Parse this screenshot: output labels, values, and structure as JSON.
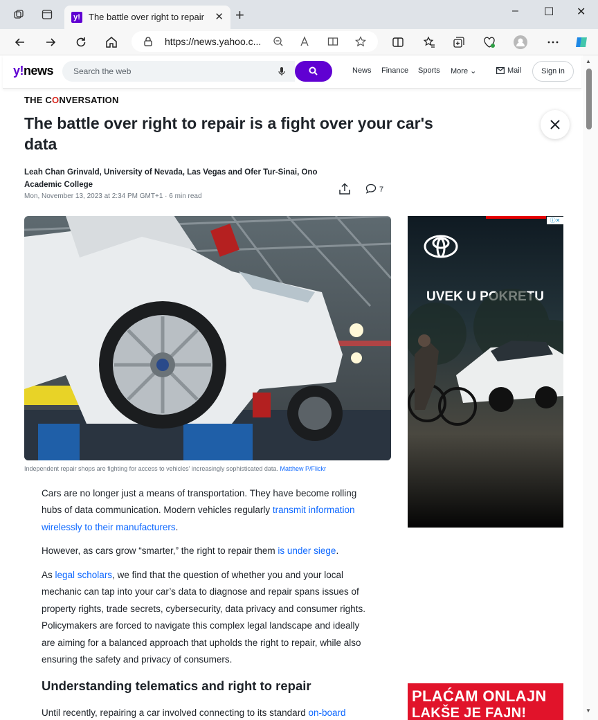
{
  "browser": {
    "tab_title": "The battle over right to repair is a fight over your car's data",
    "tab_favicon_letter": "y!",
    "url": "https://news.yahoo.c...",
    "window_minimize": "–",
    "window_maximize": "☐",
    "window_close": "✕"
  },
  "yahoo_header": {
    "logo_prefix": "y!",
    "logo_suffix": "news",
    "search_placeholder": "Search the web",
    "nav": [
      "News",
      "Finance",
      "Sports",
      "More"
    ],
    "more_chevron": "⌄",
    "mail_label": "Mail",
    "signin_label": "Sign in"
  },
  "article": {
    "source_pre": "THE C",
    "source_o": "O",
    "source_post": "NVERSATION",
    "headline": "The battle over right to repair is a fight over your car's data",
    "byline": "Leah Chan Grinvald, University of Nevada, Las Vegas and Ofer Tur-Sinai, Ono Academic College",
    "date": "Mon, November 13, 2023 at 2:34 PM GMT+1",
    "separator": "·",
    "read_time": "6 min read",
    "comment_count": "7",
    "caption_text": "Independent repair shops are fighting for access to vehicles' increasingly sophisticated data.",
    "caption_credit": "Matthew P/Flickr",
    "p1_a": "Cars are no longer just a means of transportation. They have become rolling hubs of data communication. Modern vehicles regularly ",
    "p1_link": "transmit information wirelessly to their manufacturers",
    "p1_b": ".",
    "p2_a": "However, as cars grow “smarter,” the right to repair them ",
    "p2_link": "is under siege",
    "p2_b": ".",
    "p3_a": "As ",
    "p3_link": "legal scholars",
    "p3_b": ", we find that the question of whether you and your local mechanic can tap into your car’s data to diagnose and repair spans issues of property rights, trade secrets, cybersecurity, data privacy and consumer rights. Policymakers are forced to navigate this complex legal landscape and ideally are aiming for a balanced approach that upholds the right to repair, while also ensuring the safety and privacy of consumers.",
    "subhead": "Understanding telematics and right to repair",
    "p4_a": "Until recently, repairing a car involved connecting to its standard ",
    "p4_link": "on-board"
  },
  "ads": {
    "ad1_slogan": "UVEK U POKRETU",
    "ad2_line1": "PLAĆAM ONLAJN",
    "ad2_line2": "LAKŠE JE FAJN!"
  },
  "colors": {
    "yahoo_purple": "#6001d2",
    "link_blue": "#0f69ff",
    "conversation_red": "#d9271e"
  }
}
